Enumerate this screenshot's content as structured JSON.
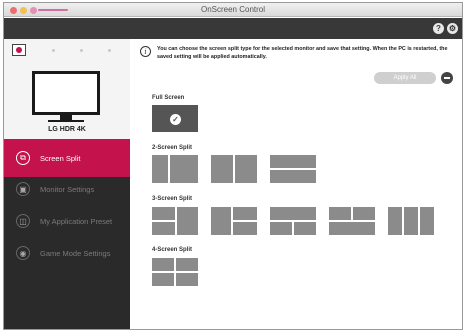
{
  "window": {
    "title": "OnScreen Control"
  },
  "topbar": {
    "help_icon": "?",
    "settings_icon": "⚙"
  },
  "sidebar": {
    "monitor_name": "LG HDR 4K",
    "items": [
      {
        "label": "Screen Split",
        "icon": "⧉"
      },
      {
        "label": "Monitor Settings",
        "icon": "▣"
      },
      {
        "label": "My Application Preset",
        "icon": "◫"
      },
      {
        "label": "Game Mode Settings",
        "icon": "◉"
      }
    ]
  },
  "content": {
    "info_icon": "i",
    "info_text": "You can choose the screen split type for the selected monitor and save that setting. When the PC is restarted, the saved setting will be applied automatically.",
    "apply_label": "Apply All",
    "sections": {
      "full": "Full Screen",
      "two": "2-Screen Split",
      "three": "3-Screen Split",
      "four": "4-Screen Split"
    },
    "check_mark": "✓"
  },
  "colors": {
    "accent": "#c4124c",
    "sidebar_bg": "#2a2a2a",
    "topbar_bg": "#383838",
    "tile": "#8b8b8b"
  }
}
